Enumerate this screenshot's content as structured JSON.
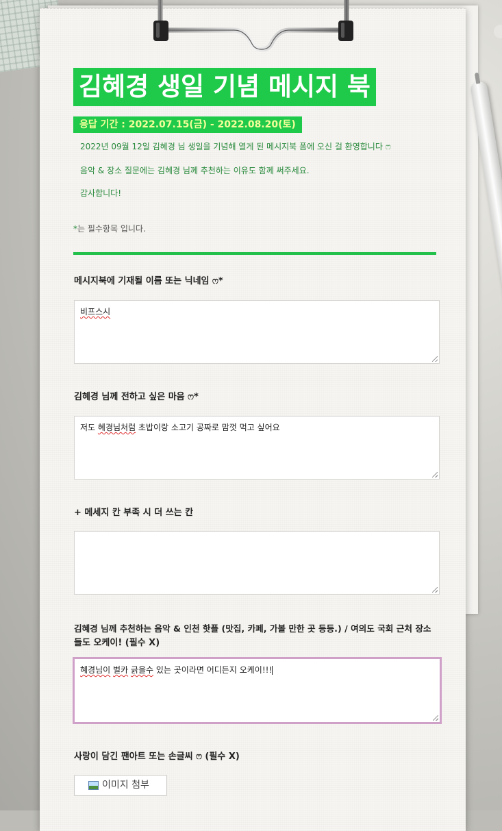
{
  "form": {
    "title": "김혜경 생일 기념 메시지 북",
    "period": "응답 기간 : 2022.07.15(금) - 2022.08.20(토)",
    "intro": [
      "2022년 09월 12일 김혜경 님 생일을 기념해 열게 된 메시지북 폼에 오신 걸 환영합니다 ෆ",
      "음악 & 장소 질문에는 김혜경 님께 추천하는 이유도 함께 써주세요.",
      "감사합니다!"
    ],
    "required_note_star": "*",
    "required_note_text": "는 필수항목 입니다."
  },
  "questions": [
    {
      "label": "메시지북에 기재될 이름 또는 닉네임 ෆ*",
      "answer": "비프스시"
    },
    {
      "label": "김혜경 님께 전하고 싶은 마음 ෆ*",
      "answer_parts": [
        "저도 ",
        "혜경님처럼",
        " 초밥이랑 소고기 공짜로 맘껏 먹고 싶어요"
      ]
    },
    {
      "label": "+ 메세지 칸 부족 시 더 쓰는 칸",
      "answer": ""
    },
    {
      "label_line1": "김혜경 님께 추천하는 음악 & 인천 핫플 (맛집, 카페, 가볼 만한 곳 등등.) / 여의도 국회 근처 장소",
      "label_line2": "들도 오케이! (필수 X)",
      "answer_parts": [
        "혜경님이",
        " ",
        "벌카",
        " ",
        "긁을수",
        " 있는 곳이라면 어디든지 오케이!!!"
      ]
    },
    {
      "label": "사랑이 담긴 팬아트 또는 손글씨 ෆ (필수 X)",
      "button_label": "이미지 첨부",
      "button_icon": "image-icon"
    }
  ],
  "colors": {
    "accent_green": "#1fc94a",
    "period_text": "#f4ff9a",
    "intro_text": "#2a8a3e",
    "focus_border": "#cfa0c8"
  }
}
